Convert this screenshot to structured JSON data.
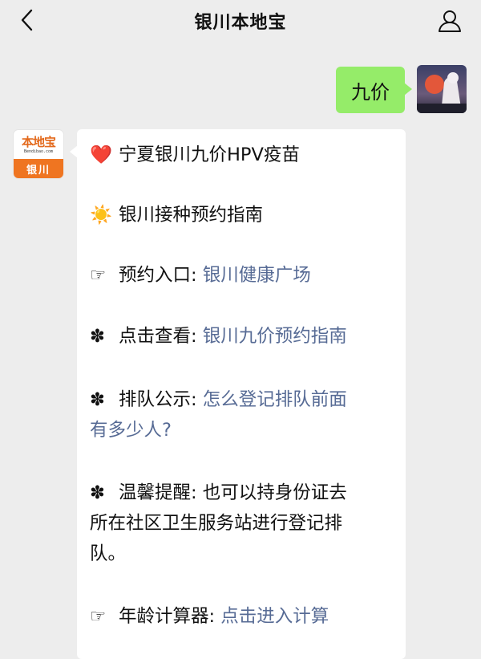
{
  "header": {
    "title": "银川本地宝"
  },
  "user_message": {
    "text": "九价"
  },
  "bot_avatar": {
    "logo_text": "本地宝",
    "logo_url": "Bendibao.com",
    "city": "银川"
  },
  "bot_message": {
    "line1": {
      "icon": "❤️",
      "text": "宁夏银川九价HPV疫苗"
    },
    "line2": {
      "icon": "☀️",
      "text": "银川接种预约指南"
    },
    "line3": {
      "icon": "☞",
      "label": "预约入口:",
      "link": "银川健康广场"
    },
    "line4": {
      "icon": "✽",
      "label": "点击查看:",
      "link": "银川九价预约指南"
    },
    "line5": {
      "icon": "✽",
      "label": "排队公示:",
      "link_part1": "怎么登记排队前面",
      "link_part2": "有多少人?"
    },
    "line6": {
      "icon": "✽",
      "label": "温馨提醒:",
      "text_part1": "也可以持身份证去",
      "text_part2": "所在社区卫生服务站进行登记排",
      "text_part3": "队。"
    },
    "line7": {
      "icon": "☞",
      "label": "年龄计算器:",
      "link": "点击进入计算"
    }
  },
  "colors": {
    "background": "#ededed",
    "user_bubble": "#95ec69",
    "link": "#576b95",
    "logo_orange": "#ef7521"
  }
}
